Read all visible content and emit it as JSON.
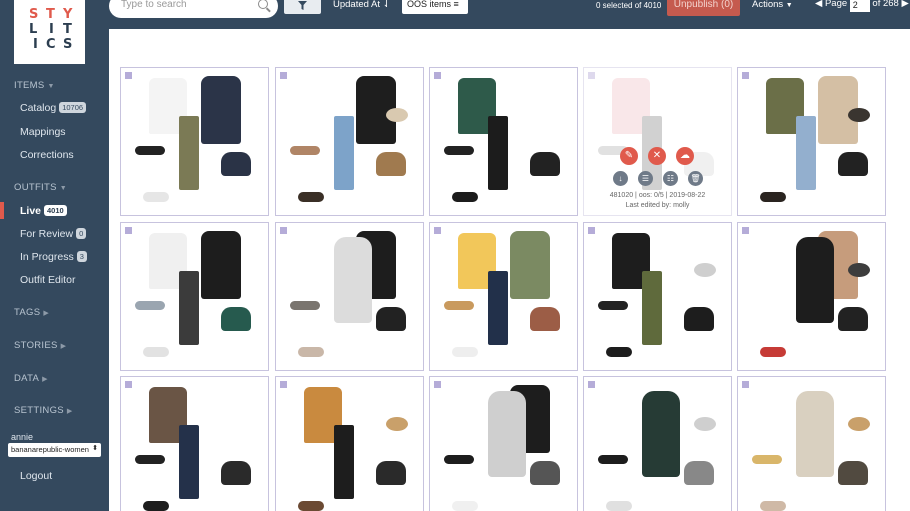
{
  "brand": {
    "logo_letters": [
      "S",
      "T",
      "Y",
      "L",
      "I",
      "T",
      "I",
      "C",
      "S"
    ]
  },
  "sidebar": {
    "items_header": "ITEMS",
    "catalog_label": "Catalog",
    "catalog_count": "10706",
    "mappings_label": "Mappings",
    "corrections_label": "Corrections",
    "outfits_header": "OUTFITS",
    "live_label": "Live",
    "live_count": "4010",
    "review_label": "For Review",
    "review_count": "0",
    "progress_label": "In Progress",
    "progress_count": "3",
    "editor_label": "Outfit Editor",
    "tags_header": "TAGS",
    "stories_header": "STORIES",
    "data_header": "DATA",
    "settings_header": "SETTINGS",
    "user": "annie",
    "retailer": "bananarepublic-women",
    "logout_label": "Logout"
  },
  "toolbar": {
    "search_placeholder": "Type to search",
    "sort_label": "Updated At",
    "oos_label": "OOS items",
    "selected_text": "0 selected of 4010",
    "unpublish_label": "Unpublish (0)",
    "actions_label": "Actions",
    "page_label": "Page",
    "page_value": "2",
    "page_total": "of 268"
  },
  "hover": {
    "meta_line": "481020 | oos: 0/5 | 2019-08-22",
    "edited_by": "Last edited by: molly"
  },
  "colors": {
    "sidebar": "#34495e",
    "accent": "#e05a4c",
    "checkbox": "#b5acd8"
  },
  "outfits": [
    {
      "items": [
        {
          "c": "#f4f4f4",
          "s": "top"
        },
        {
          "c": "#2b3448",
          "s": "coat"
        },
        {
          "c": "#7b7a55",
          "s": "pants"
        },
        {
          "c": "#222",
          "s": "glasses"
        },
        {
          "c": "#2a3346",
          "s": "bag"
        },
        {
          "c": "#e6e6e6",
          "s": "shoes"
        }
      ]
    },
    {
      "items": [
        {
          "c": "#1e1e1e",
          "s": "coat"
        },
        {
          "c": "#7da3c9",
          "s": "pants"
        },
        {
          "c": "#b08566",
          "s": "glasses"
        },
        {
          "c": "#a07a4f",
          "s": "bag"
        },
        {
          "c": "#d9c9b0",
          "s": "jewel"
        },
        {
          "c": "#3a2f26",
          "s": "shoes"
        }
      ]
    },
    {
      "items": [
        {
          "c": "#2e5a4a",
          "s": "top"
        },
        {
          "c": "#1c1c1c",
          "s": "pants"
        },
        {
          "c": "#222",
          "s": "glasses"
        },
        {
          "c": "#222",
          "s": "bag"
        },
        {
          "c": "#1c1c1c",
          "s": "shoes"
        }
      ]
    },
    {
      "items": [
        {
          "c": "#f1c9cf",
          "s": "top"
        },
        {
          "c": "#bdbdbd",
          "s": "glasses"
        },
        {
          "c": "#ddd",
          "s": "bag"
        },
        {
          "c": "#999",
          "s": "pants"
        }
      ]
    },
    {
      "items": [
        {
          "c": "#6b6f48",
          "s": "top"
        },
        {
          "c": "#d4bfa4",
          "s": "coat"
        },
        {
          "c": "#93afce",
          "s": "pants"
        },
        {
          "c": "#222",
          "s": "bag"
        },
        {
          "c": "#3a3530",
          "s": "jewel"
        },
        {
          "c": "#2a2420",
          "s": "shoes"
        }
      ]
    },
    {
      "items": [
        {
          "c": "#f0f0f0",
          "s": "top"
        },
        {
          "c": "#1d1d1d",
          "s": "coat"
        },
        {
          "c": "#3b3b3b",
          "s": "pants"
        },
        {
          "c": "#9aa5b0",
          "s": "glasses"
        },
        {
          "c": "#265a4e",
          "s": "bag"
        },
        {
          "c": "#e2e2e2",
          "s": "shoes"
        }
      ]
    },
    {
      "items": [
        {
          "c": "#1d1d1d",
          "s": "coat"
        },
        {
          "c": "#dcdcdc",
          "s": "dress"
        },
        {
          "c": "#7a756f",
          "s": "glasses"
        },
        {
          "c": "#222",
          "s": "bag"
        },
        {
          "c": "#c9b7a8",
          "s": "shoes"
        }
      ]
    },
    {
      "items": [
        {
          "c": "#f2c75a",
          "s": "top"
        },
        {
          "c": "#7b8a62",
          "s": "coat"
        },
        {
          "c": "#22304a",
          "s": "pants"
        },
        {
          "c": "#c99a5e",
          "s": "glasses"
        },
        {
          "c": "#9c5d46",
          "s": "bag"
        },
        {
          "c": "#eee",
          "s": "shoes"
        }
      ]
    },
    {
      "items": [
        {
          "c": "#1d1d1d",
          "s": "top"
        },
        {
          "c": "#5f6a3c",
          "s": "pants"
        },
        {
          "c": "#222",
          "s": "glasses"
        },
        {
          "c": "#1d1d1d",
          "s": "bag"
        },
        {
          "c": "#cfcfcf",
          "s": "jewel"
        },
        {
          "c": "#1d1d1d",
          "s": "shoes"
        }
      ]
    },
    {
      "items": [
        {
          "c": "#c69c7c",
          "s": "coat"
        },
        {
          "c": "#1d1d1d",
          "s": "dress"
        },
        {
          "c": "#3d3d3d",
          "s": "jewel"
        },
        {
          "c": "#222",
          "s": "bag"
        },
        {
          "c": "#c63b36",
          "s": "shoes"
        }
      ]
    },
    {
      "items": [
        {
          "c": "#6a5545",
          "s": "top"
        },
        {
          "c": "#24314a",
          "s": "pants"
        },
        {
          "c": "#222",
          "s": "glasses"
        },
        {
          "c": "#2a2a2a",
          "s": "bag"
        },
        {
          "c": "#1d1d1d",
          "s": "shoes"
        }
      ]
    },
    {
      "items": [
        {
          "c": "#c98a3f",
          "s": "top"
        },
        {
          "c": "#1d1d1d",
          "s": "pants"
        },
        {
          "c": "#c9a06a",
          "s": "jewel"
        },
        {
          "c": "#2a2a2a",
          "s": "bag"
        },
        {
          "c": "#6b4a33",
          "s": "shoes"
        }
      ]
    },
    {
      "items": [
        {
          "c": "#1d1d1d",
          "s": "coat"
        },
        {
          "c": "#cfcfcf",
          "s": "dress"
        },
        {
          "c": "#1d1d1d",
          "s": "glasses"
        },
        {
          "c": "#555",
          "s": "bag"
        },
        {
          "c": "#f0f0f0",
          "s": "shoes"
        }
      ]
    },
    {
      "items": [
        {
          "c": "#263b35",
          "s": "dress"
        },
        {
          "c": "#1d1d1d",
          "s": "glasses"
        },
        {
          "c": "#cfcfcf",
          "s": "jewel"
        },
        {
          "c": "#888",
          "s": "bag"
        },
        {
          "c": "#e0e0e0",
          "s": "shoes"
        }
      ]
    },
    {
      "items": [
        {
          "c": "#d9d0c0",
          "s": "dress"
        },
        {
          "c": "#c9a06a",
          "s": "jewel"
        },
        {
          "c": "#d9b66a",
          "s": "glasses"
        },
        {
          "c": "#514a40",
          "s": "bag"
        },
        {
          "c": "#cfb9a6",
          "s": "shoes"
        }
      ]
    }
  ]
}
